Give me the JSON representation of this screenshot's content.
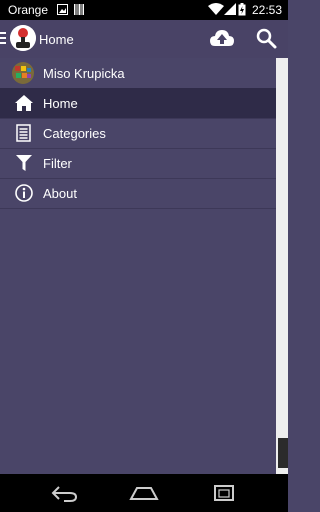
{
  "status_bar": {
    "carrier": "Orange",
    "time": "22:53",
    "icons": [
      "image-notification-icon",
      "barcode-notification-icon",
      "wifi-icon",
      "signal-icon",
      "battery-icon"
    ]
  },
  "action_bar": {
    "title": "Home",
    "icons": [
      "drawer-toggle-icon",
      "app-logo-icon",
      "cloud-upload-icon",
      "search-icon"
    ]
  },
  "drawer": {
    "items": [
      {
        "label": "Miso Krupicka",
        "icon": "user-avatar-icon"
      },
      {
        "label": "Home",
        "icon": "home-icon",
        "active": true
      },
      {
        "label": "Categories",
        "icon": "list-icon"
      },
      {
        "label": "Filter",
        "icon": "filter-icon"
      },
      {
        "label": "About",
        "icon": "info-icon"
      }
    ]
  },
  "nav_bar": {
    "icons": [
      "back-icon",
      "home-nav-icon",
      "recent-apps-icon"
    ]
  },
  "colors": {
    "drawer_bg": "#4a4568",
    "active_item_bg": "#2f2b48",
    "action_bar_bg": "#494366",
    "text": "#ffffff"
  }
}
